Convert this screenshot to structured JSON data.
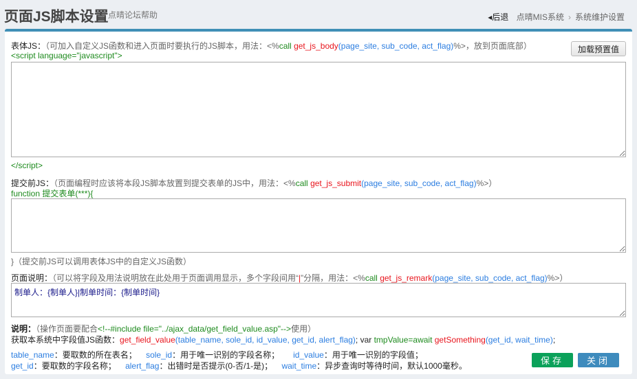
{
  "header": {
    "title": "页面JS脚本设置",
    "subtitle": "» 点晴论坛帮助",
    "back": "后退",
    "crumb1": "点晴MIS系统",
    "crumb_sep": "›",
    "crumb2": "系统维护设置"
  },
  "body_js": {
    "label": "表体JS：",
    "hint": "（可加入自定义JS函数和进入页面时要执行的JS脚本，用法：<%",
    "call": "call",
    "fn": "get_js_body",
    "args": "(page_site, sub_code, act_flag)",
    "tail": "%>，放到页面底部）",
    "open_tag": "<script language=\"javascript\">",
    "close_tag": "</script>",
    "value": "",
    "preset_button": "加载预置值"
  },
  "submit_js": {
    "label": "提交前JS：",
    "hint": "（页面编程时应该将本段JS脚本放置到提交表单的JS中，用法：<%",
    "call": "call",
    "fn": "get_js_submit",
    "args": "(page_site, sub_code, act_flag)",
    "tail": "%>）",
    "func_open": "function 提交表单(***){",
    "value": "",
    "func_close": "}（提交前JS可以调用表体JS中的自定义JS函数）"
  },
  "remark": {
    "label": "页面说明：",
    "hint": "（可以将字段及用法说明放在此处用于页面调用显示，多个字段间用“",
    "pipe": "|",
    "hint2": "”分隔，用法：<%",
    "call": "call",
    "fn": "get_js_remark",
    "args": "(page_site, sub_code, act_flag)",
    "tail": "%>）",
    "value": "制单人：{制单人}|制单时间：{制单时间}"
  },
  "notes": {
    "label": "说明：",
    "hint1": "（操作页面要配合",
    "include": "<!--#include file=\"../ajax_data/get_field_value.asp\"-->",
    "hint2": "使用）",
    "l2a": "获取本系统中字段值JS函数：",
    "l2fn": "get_field_value",
    "l2args": "(table_name, sole_id, id_value, get_id, alert_flag)",
    "l2b": "; var ",
    "l2c": "tmpValue=await",
    "l2fn2": " getSomething",
    "l2args2": "(get_id, wait_time)",
    "l2d": ";",
    "p": [
      [
        "table_name",
        "：要取数的所在表名；"
      ],
      [
        "sole_id",
        "：用于唯一识别的字段名称；"
      ],
      [
        "id_value",
        "：用于唯一识别的字段值；"
      ],
      [
        "get_id",
        "：要取数的字段名称；"
      ],
      [
        "alert_flag",
        "：出错时是否提示(0-否/1-是)；"
      ],
      [
        "wait_time",
        "：异步查询时等待时间，默认1000毫秒。"
      ]
    ]
  },
  "buttons": {
    "save": "保存",
    "close": "关闭"
  }
}
